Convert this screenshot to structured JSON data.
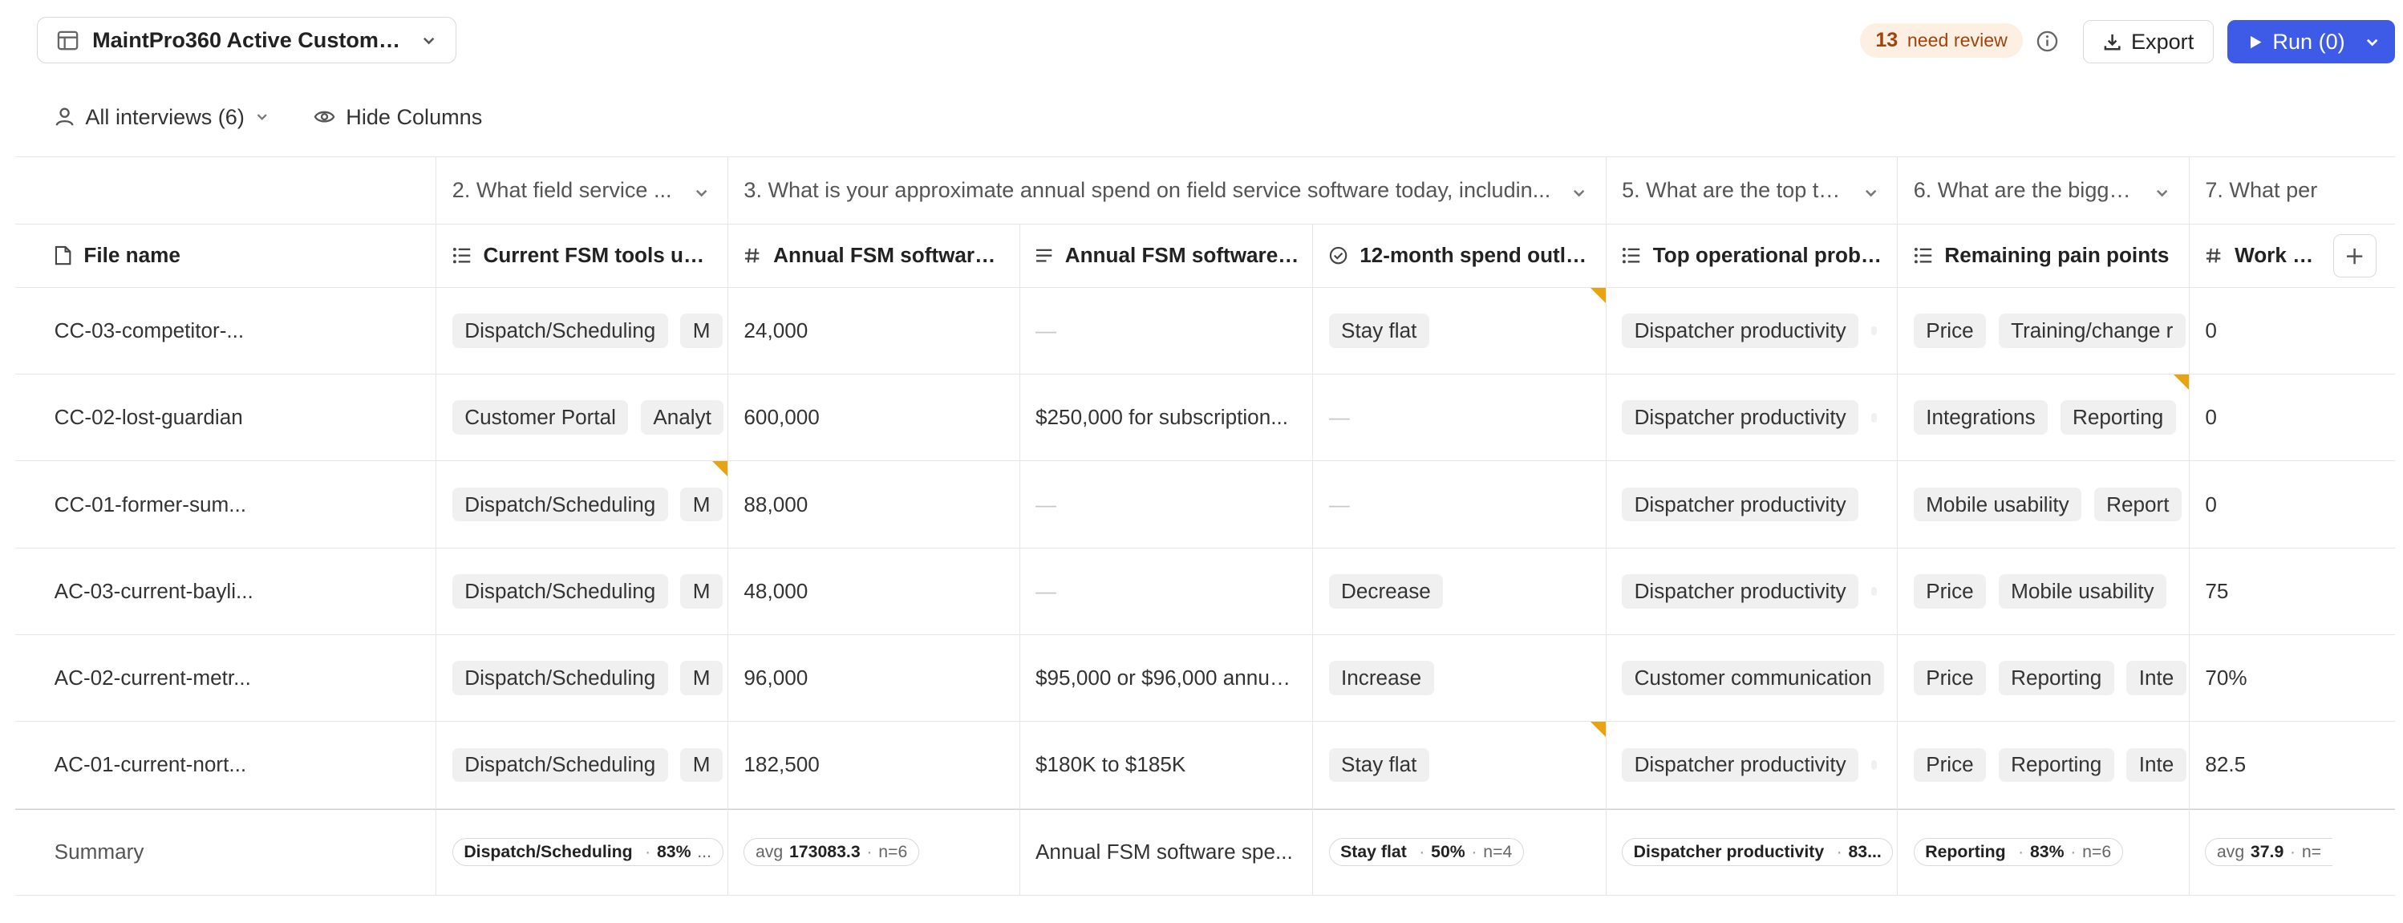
{
  "document_select": {
    "label": "MaintPro360 Active Customers..."
  },
  "review_badge": {
    "count": "13",
    "label": "need review"
  },
  "toolbar": {
    "export_label": "Export",
    "run_label": "Run (0)"
  },
  "filters": {
    "interviews_label": "All interviews (6)",
    "hide_columns_label": "Hide Columns"
  },
  "groups": [
    {
      "label": "2. What field service ..."
    },
    {
      "label": "3. What is your approximate annual spend on field service software today, includin..."
    },
    {
      "label": "5. What are the top thr..."
    },
    {
      "label": "6. What are the bigges..."
    },
    {
      "label": "7. What per"
    }
  ],
  "columns": [
    {
      "label": "File name",
      "icon": "file-icon"
    },
    {
      "label": "Current FSM tools used",
      "icon": "list-icon"
    },
    {
      "label": "Annual FSM software ...",
      "icon": "hash-icon"
    },
    {
      "label": "Annual FSM software ...",
      "icon": "text-icon"
    },
    {
      "label": "12-month spend outlo...",
      "icon": "check-circle-icon"
    },
    {
      "label": "Top operational proble...",
      "icon": "list-icon"
    },
    {
      "label": "Remaining pain points",
      "icon": "list-icon"
    },
    {
      "label": "Work ord",
      "icon": "hash-icon"
    }
  ],
  "rows": [
    {
      "file": "CC-03-competitor-...",
      "tools": [
        "Dispatch/Scheduling",
        "M"
      ],
      "spend": "24,000",
      "spend_text": "—",
      "outlook": "Stay flat",
      "problems": [
        "Dispatcher productivity"
      ],
      "pain": [
        "Price",
        "Training/change r"
      ],
      "work": "0"
    },
    {
      "file": "CC-02-lost-guardian",
      "tools": [
        "Customer Portal",
        "Analyt"
      ],
      "spend": "600,000",
      "spend_text": "$250,000 for subscription...",
      "outlook": "—",
      "problems": [
        "Dispatcher productivity"
      ],
      "pain": [
        "Integrations",
        "Reporting"
      ],
      "work": "0"
    },
    {
      "file": "CC-01-former-sum...",
      "tools": [
        "Dispatch/Scheduling",
        "M"
      ],
      "spend": "88,000",
      "spend_text": "—",
      "outlook": "—",
      "problems": [
        "Dispatcher productivity"
      ],
      "pain": [
        "Mobile usability",
        "Report"
      ],
      "work": "0"
    },
    {
      "file": "AC-03-current-bayli...",
      "tools": [
        "Dispatch/Scheduling",
        "M"
      ],
      "spend": "48,000",
      "spend_text": "—",
      "outlook": "Decrease",
      "problems": [
        "Dispatcher productivity"
      ],
      "pain": [
        "Price",
        "Mobile usability"
      ],
      "work": "75"
    },
    {
      "file": "AC-02-current-metr...",
      "tools": [
        "Dispatch/Scheduling",
        "M"
      ],
      "spend": "96,000",
      "spend_text": "$95,000 or $96,000 annua...",
      "outlook": "Increase",
      "problems": [
        "Customer communication"
      ],
      "pain": [
        "Price",
        "Reporting",
        "Inte"
      ],
      "work": "70%"
    },
    {
      "file": "AC-01-current-nort...",
      "tools": [
        "Dispatch/Scheduling",
        "M"
      ],
      "spend": "182,500",
      "spend_text": "$180K to $185K",
      "outlook": "Stay flat",
      "problems": [
        "Dispatcher productivity"
      ],
      "pain": [
        "Price",
        "Reporting",
        "Inte"
      ],
      "work": "82.5"
    }
  ],
  "summary": {
    "label": "Summary",
    "tools": {
      "value": "Dispatch/Scheduling",
      "pct": "83%",
      "tail": "..."
    },
    "spend": {
      "prefix": "avg",
      "value": "173083.3",
      "n": "n=6"
    },
    "spend_text": "Annual FSM software spe...",
    "outlook": {
      "value": "Stay flat",
      "pct": "50%",
      "n": "n=4"
    },
    "problems": {
      "value": "Dispatcher productivity",
      "pct": "83..."
    },
    "pain": {
      "value": "Reporting",
      "pct": "83%",
      "n": "n=6"
    },
    "work": {
      "prefix": "avg",
      "value": "37.9",
      "n": "n="
    }
  },
  "colors": {
    "accent": "#3e5be8",
    "review_bg": "#fdf0e3",
    "review_text": "#a2420c",
    "flag": "#e8a310"
  }
}
